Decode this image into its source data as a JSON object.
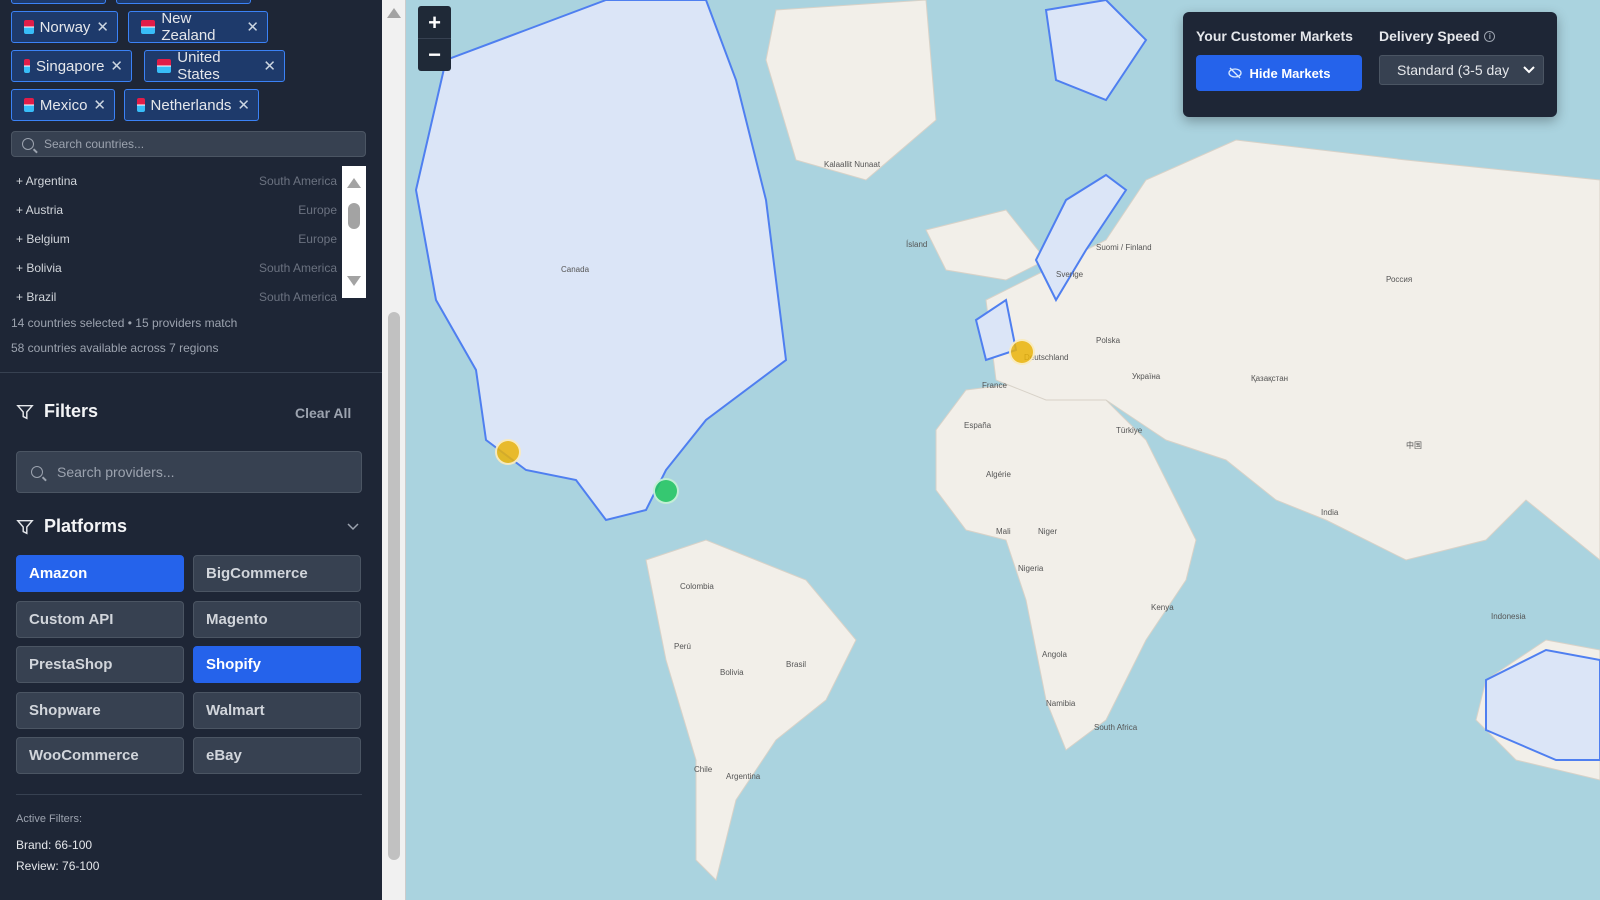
{
  "selected_countries": [
    "Norway",
    "New Zealand",
    "Singapore",
    "United States",
    "Mexico",
    "Netherlands"
  ],
  "country_search": {
    "placeholder": "Search countries..."
  },
  "country_list": [
    {
      "name": "+ Argentina",
      "region": "South America"
    },
    {
      "name": "+ Austria",
      "region": "Europe"
    },
    {
      "name": "+ Belgium",
      "region": "Europe"
    },
    {
      "name": "+ Bolivia",
      "region": "South America"
    },
    {
      "name": "+ Brazil",
      "region": "South America"
    }
  ],
  "stats": {
    "selected": "14 countries selected • 15 providers match",
    "available": "58 countries available across 7 regions"
  },
  "filters": {
    "title": "Filters",
    "clear_all": "Clear All",
    "search_placeholder": "Search providers..."
  },
  "platforms": {
    "title": "Platforms",
    "items": [
      {
        "label": "Amazon",
        "active": true
      },
      {
        "label": "BigCommerce",
        "active": false
      },
      {
        "label": "Custom API",
        "active": false
      },
      {
        "label": "Magento",
        "active": false
      },
      {
        "label": "PrestaShop",
        "active": false
      },
      {
        "label": "Shopify",
        "active": true
      },
      {
        "label": "Shopware",
        "active": false
      },
      {
        "label": "Walmart",
        "active": false
      },
      {
        "label": "WooCommerce",
        "active": false
      },
      {
        "label": "eBay",
        "active": false
      }
    ]
  },
  "active_filters": {
    "title": "Active Filters:",
    "brand": "Brand: 66-100",
    "review": "Review: 76-100"
  },
  "map": {
    "zoom_in": "+",
    "zoom_out": "−",
    "labels": [
      "Canada",
      "Kalaallit Nunaat",
      "Ísland",
      "Brasil",
      "Colombia",
      "Perú",
      "Bolivia",
      "Argentina",
      "Chile",
      "Россия",
      "Қазақстан",
      "中国",
      "India",
      "Algérie",
      "Niger",
      "Mali",
      "Nigeria",
      "Angola",
      "Namibia",
      "South Africa",
      "Kenya",
      "Indonesia",
      "France",
      "España",
      "Deutschland",
      "Türkiye",
      "Polska",
      "Україна",
      "Sverige",
      "Suomi / Finland"
    ],
    "colors": {
      "ocean": "#aad3df",
      "land": "#f2efe9",
      "market_fill": "#dbe5f7",
      "market_border": "#4f7ff0",
      "marker_yellow": "#eab308",
      "marker_green": "#22c55e"
    }
  },
  "panel": {
    "markets_title": "Your Customer Markets",
    "hide_markets": "Hide Markets",
    "delivery_title": "Delivery Speed",
    "delivery_value": "Standard (3-5 day"
  }
}
